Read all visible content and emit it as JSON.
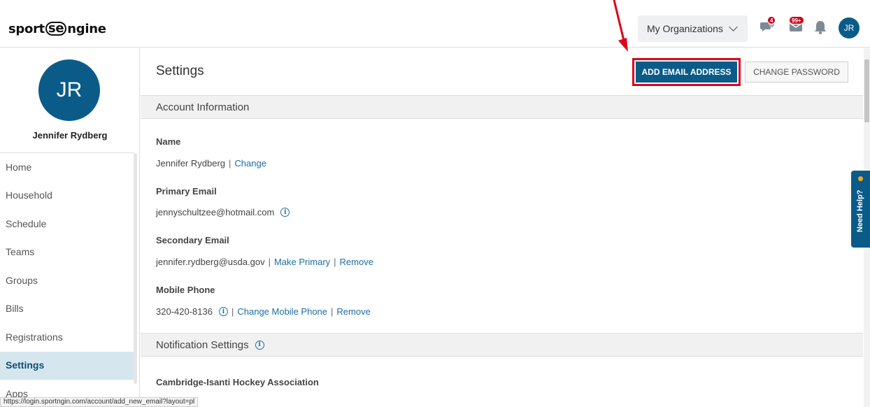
{
  "header": {
    "logo_text_pre": "sport",
    "logo_text_mid": "se",
    "logo_text_post": "ngine",
    "orgs_label": "My Organizations",
    "messages_badge": "4",
    "mail_badge": "99+",
    "user_initials": "JR"
  },
  "sidebar": {
    "avatar_initials": "JR",
    "user_name": "Jennifer Rydberg",
    "items": [
      {
        "label": "Home"
      },
      {
        "label": "Household"
      },
      {
        "label": "Schedule"
      },
      {
        "label": "Teams"
      },
      {
        "label": "Groups"
      },
      {
        "label": "Bills"
      },
      {
        "label": "Registrations"
      },
      {
        "label": "Settings"
      },
      {
        "label": "Apps"
      }
    ]
  },
  "main": {
    "title": "Settings",
    "add_email_label": "ADD EMAIL ADDRESS",
    "change_password_label": "CHANGE PASSWORD",
    "account_section": "Account Information",
    "name_label": "Name",
    "name_value": "Jennifer Rydberg",
    "name_change": "Change",
    "primary_email_label": "Primary Email",
    "primary_email_value": "jennyschultzee@hotmail.com",
    "secondary_email_label": "Secondary Email",
    "secondary_email_value": "jennifer.rydberg@usda.gov",
    "make_primary": "Make Primary",
    "remove": "Remove",
    "mobile_label": "Mobile Phone",
    "mobile_value": "320-420-8136",
    "change_mobile": "Change Mobile Phone",
    "notification_section": "Notification Settings",
    "org_name": "Cambridge-Isanti Hockey Association"
  },
  "separator": "|",
  "need_help_label": "Need Help?",
  "status_url": "https://login.sportngin.com/account/add_new_email?layout=pl",
  "colors": {
    "brand_blue": "#0b5b89",
    "link_blue": "#1c6ea4",
    "highlight_red": "#e0001b",
    "active_nav_bg": "#d6e6ef"
  }
}
